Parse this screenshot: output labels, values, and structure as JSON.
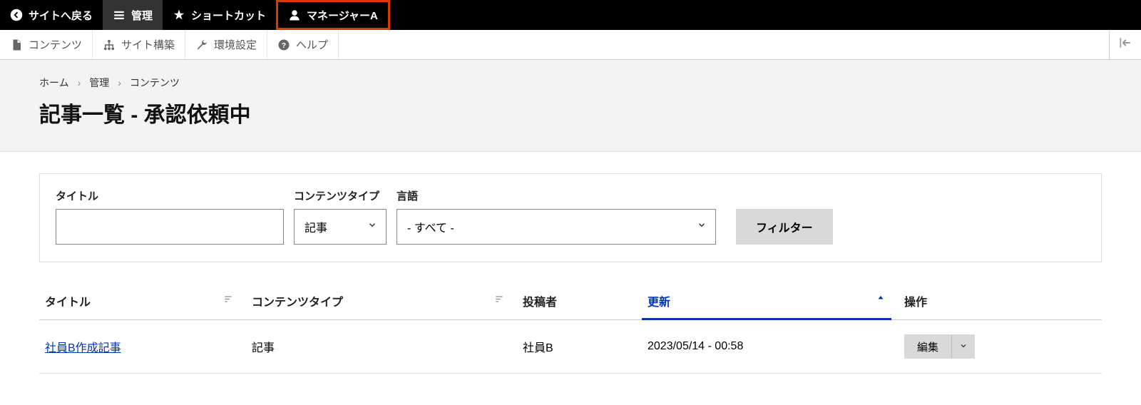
{
  "topToolbar": {
    "back": "サイトへ戻る",
    "admin": "管理",
    "shortcut": "ショートカット",
    "user": "マネージャーA"
  },
  "secondaryToolbar": {
    "content": "コンテンツ",
    "structure": "サイト構築",
    "settings": "環境設定",
    "help": "ヘルプ"
  },
  "breadcrumb": {
    "home": "ホーム",
    "admin": "管理",
    "content": "コンテンツ"
  },
  "pageTitle": "記事一覧 - 承認依頼中",
  "filter": {
    "titleLabel": "タイトル",
    "titleValue": "",
    "typeLabel": "コンテンツタイプ",
    "typeValue": "記事",
    "langLabel": "言語",
    "langValue": "- すべて -",
    "buttonLabel": "フィルター"
  },
  "table": {
    "headers": {
      "title": "タイトル",
      "type": "コンテンツタイプ",
      "author": "投稿者",
      "updated": "更新",
      "actions": "操作"
    },
    "rows": [
      {
        "title": "社員B作成記事",
        "type": "記事",
        "author": "社員B",
        "updated": "2023/05/14 - 00:58",
        "action": "編集"
      }
    ]
  }
}
